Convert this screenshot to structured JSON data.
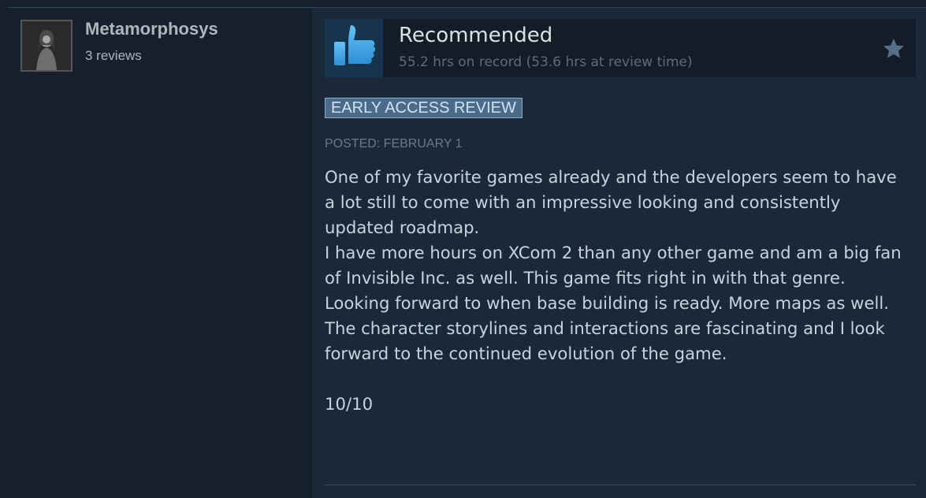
{
  "reviewer": {
    "name": "Metamorphosys",
    "review_count": "3 reviews",
    "avatar_icon": "user-avatar-icon"
  },
  "review": {
    "vote": "Recommended",
    "vote_icon": "thumbs-up-icon",
    "hours": "55.2 hrs on record (53.6 hrs at review time)",
    "award_icon": "star-icon",
    "badge": "EARLY ACCESS REVIEW",
    "posted": "POSTED: FEBRUARY 1",
    "paragraphs": [
      "One of my favorite games already and the developers seem to have a lot still to come with an impressive looking and consistently updated roadmap.",
      "I have more hours on XCom 2 than any other game and am a big fan of Invisible Inc. as well. This game fits right in with that genre.",
      "Looking forward to when base building is ready. More maps as well.",
      "The character storylines and interactions are fascinating and I look forward to the continued evolution of the game.",
      "",
      "10/10"
    ]
  },
  "colors": {
    "background": "#1b2838",
    "thumb_blue": "#3ea4e4",
    "badge_bg": "#4c6b8a"
  }
}
